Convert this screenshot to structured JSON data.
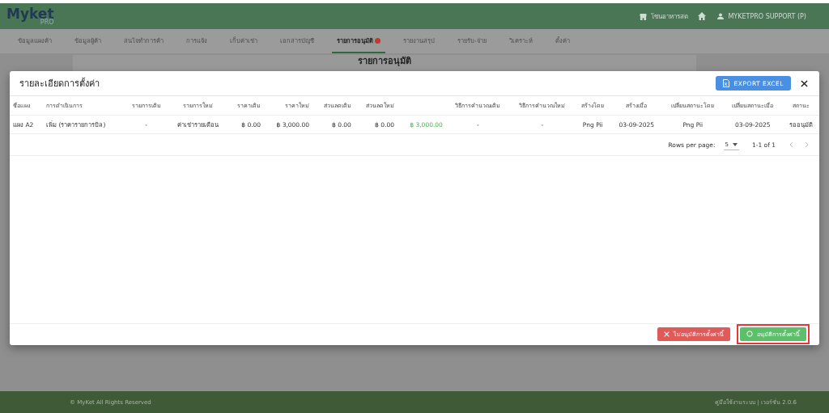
{
  "header": {
    "logo": "Myket",
    "logo_sub": "PRO",
    "store": "โซนอาหารสด",
    "user": "MYKETPRO SUPPORT (P)"
  },
  "nav": [
    {
      "label": "ข้อมูลแผงค้า",
      "selected": false,
      "badge": false
    },
    {
      "label": "ข้อมูลผู้ค้า",
      "selected": false,
      "badge": false
    },
    {
      "label": "สนใจทำการค้า",
      "selected": false,
      "badge": false
    },
    {
      "label": "การแจ้ง",
      "selected": false,
      "badge": false
    },
    {
      "label": "เก็บค่าเช่า",
      "selected": false,
      "badge": false
    },
    {
      "label": "เอกสารบัญชี",
      "selected": false,
      "badge": false
    },
    {
      "label": "รายการอนุมัติ",
      "selected": true,
      "badge": true
    },
    {
      "label": "รายงานสรุป",
      "selected": false,
      "badge": false
    },
    {
      "label": "รายรับ-จ่าย",
      "selected": false,
      "badge": false
    },
    {
      "label": "วิเคราะห์",
      "selected": false,
      "badge": false
    },
    {
      "label": "ตั้งค่า",
      "selected": false,
      "badge": false
    }
  ],
  "page_title": "รายการอนุมัติ",
  "dialog": {
    "title": "รายละเอียดการตั้งค่า",
    "export_button": "EXPORT EXCEL",
    "table": {
      "columns": [
        {
          "kind": "text",
          "label": "ชื่อแผง"
        },
        {
          "kind": "text",
          "label": "การดำเนินการ"
        },
        {
          "kind": "text",
          "label": "รายการเดิม"
        },
        {
          "kind": "text",
          "label": "รายการใหม่"
        },
        {
          "kind": "text",
          "label": "ราคาเดิม"
        },
        {
          "kind": "text",
          "label": "ราคาใหม่"
        },
        {
          "kind": "text",
          "label": "ส่วนลดเดิม"
        },
        {
          "kind": "text",
          "label": "ส่วนลดใหม่"
        },
        {
          "kind": "blank"
        },
        {
          "kind": "text",
          "label": "วิธีการคำนวณเดิม"
        },
        {
          "kind": "text",
          "label": "วิธีการคำนวณใหม่"
        },
        {
          "kind": "text",
          "label": "สร้างโดย"
        },
        {
          "kind": "text",
          "label": "สร้างเมื่อ"
        },
        {
          "kind": "text",
          "label": "เปลี่ยนสถานะโดย"
        },
        {
          "kind": "text",
          "label": "เปลี่ยนสถานะเมื่อ"
        },
        {
          "kind": "text",
          "label": "สถานะ"
        }
      ],
      "rows": [
        {
          "cells": [
            {
              "text": "แผง A2",
              "highlight": false
            },
            {
              "text": "เพิ่ม (ราคารายการบิล)",
              "highlight": false
            },
            {
              "text": "-",
              "highlight": false
            },
            {
              "text": "ค่าเช่ารายเดือน",
              "highlight": false
            },
            {
              "text": "฿ 0.00",
              "highlight": false
            },
            {
              "text": "฿ 3,000.00",
              "highlight": false
            },
            {
              "text": "฿ 0.00",
              "highlight": false
            },
            {
              "text": "฿ 0.00",
              "highlight": false
            },
            {
              "text": "฿ 3,000.00",
              "highlight": true
            },
            {
              "text": "-",
              "highlight": false
            },
            {
              "text": "-",
              "highlight": false
            },
            {
              "text": "Png Pii",
              "highlight": false
            },
            {
              "text": "03-09-2025",
              "highlight": false
            },
            {
              "text": "Png Pii",
              "highlight": false
            },
            {
              "text": "03-09-2025",
              "highlight": false
            },
            {
              "text": "รออนุมัติ",
              "highlight": false
            }
          ]
        }
      ]
    },
    "pagination": {
      "rows_per_page_label": "Rows per page:",
      "rows_per_page": "5",
      "range": "1-1 of 1"
    },
    "buttons": [
      {
        "kind": "reject",
        "label": "ไม่อนุมัติการตั้งค่านี้",
        "outlined": false
      },
      {
        "kind": "approve",
        "label": "อนุมัติการตั้งค่านี้",
        "outlined": true
      }
    ]
  },
  "footer": {
    "copyright": "© MyKet All Rights Reserved",
    "links": "คู่มือใช้งานระบบ | เวอร์ชั่น 2.0.6"
  }
}
